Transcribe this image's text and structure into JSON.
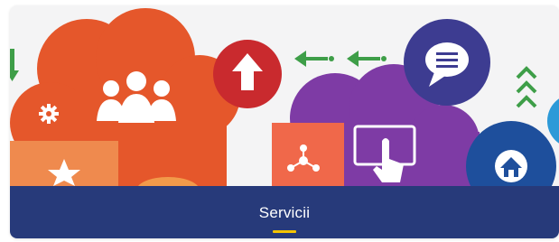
{
  "banner": {
    "label": "Servicii",
    "icons": [
      "arrow-down-icon",
      "gear-icon",
      "users-group-icon",
      "arrow-up-icon",
      "arrow-left-icon",
      "chat-bubble-icon",
      "double-chevron-up-icon",
      "touch-screen-icon",
      "network-nodes-icon",
      "star-icon",
      "home-icon"
    ]
  },
  "colors": {
    "bar_background": "#273a7a",
    "underline": "#f5c400",
    "cloud_orange": "#e5572b",
    "cloud_purple": "#7e3ba5",
    "cloud_green": "#3e9e48",
    "circle_red": "#c92a2e",
    "circle_navy": "#3d3c91",
    "circle_blue": "#1e4f9c",
    "circle_light_blue": "#2d9ad8"
  }
}
